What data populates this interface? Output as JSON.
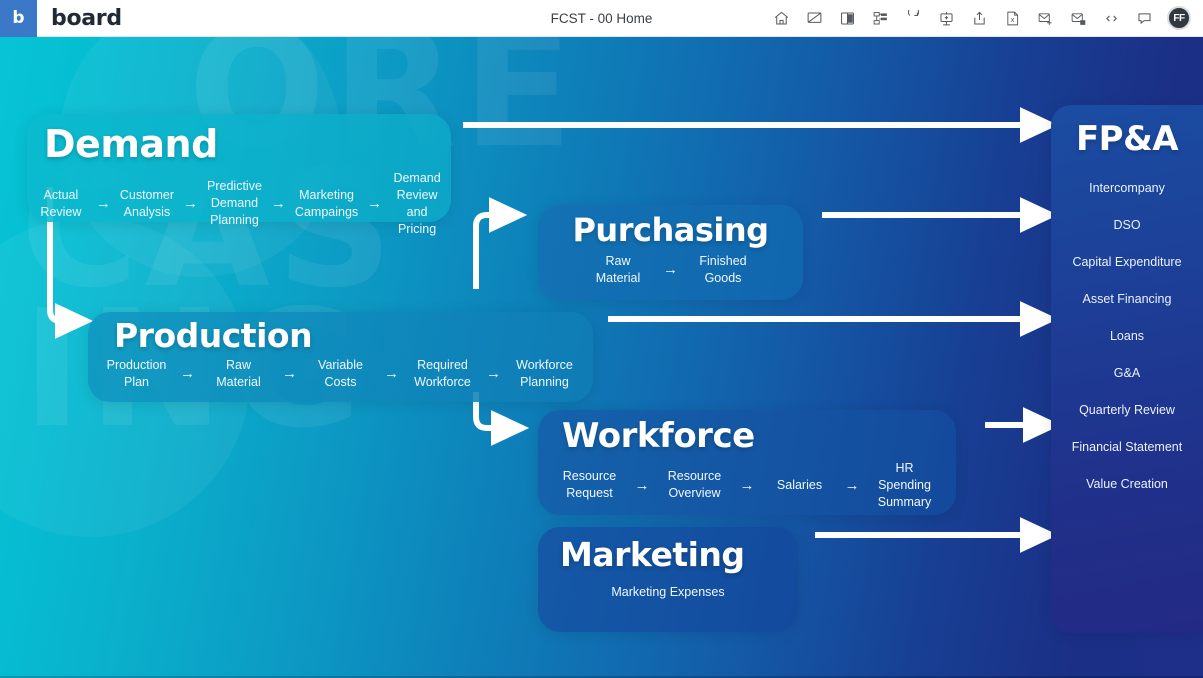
{
  "app": {
    "brand_mark": "b",
    "brand_name": "board",
    "document_title": "FCST - 00 Home",
    "avatar_initials": "FF"
  },
  "toolbar": {
    "icons": [
      {
        "name": "home-icon",
        "label": "Home"
      },
      {
        "name": "screen-off-icon",
        "label": "Screen Off"
      },
      {
        "name": "presentation-icon",
        "label": "Presentation"
      },
      {
        "name": "layout-icon",
        "label": "Layout"
      },
      {
        "name": "undo-icon",
        "label": "Undo"
      },
      {
        "name": "insert-object-icon",
        "label": "Insert Object"
      },
      {
        "name": "share-icon",
        "label": "Share"
      },
      {
        "name": "export-excel-icon",
        "label": "Export to Excel"
      },
      {
        "name": "mail-add-icon",
        "label": "New Mail"
      },
      {
        "name": "mail-schedule-icon",
        "label": "Schedule Mail"
      },
      {
        "name": "code-icon",
        "label": "Code"
      },
      {
        "name": "comment-icon",
        "label": "Comments"
      }
    ]
  },
  "canvas": {
    "watermark_lines": [
      "ORE",
      "CAS",
      "ING"
    ],
    "gradient_from": "#07c4d4",
    "gradient_to": "#1e2f8a"
  },
  "cards": {
    "demand": {
      "title": "Demand",
      "steps": [
        "Actual\nReview",
        "Customer\nAnalysis",
        "Predictive\nDemand\nPlanning",
        "Marketing\nCampaings",
        "Demand\nReview\nand Pricing"
      ]
    },
    "purchasing": {
      "title": "Purchasing",
      "steps": [
        "Raw\nMaterial",
        "Finished\nGoods"
      ]
    },
    "production": {
      "title": "Production",
      "steps": [
        "Production\nPlan",
        "Raw\nMaterial",
        "Variable\nCosts",
        "Required\nWorkforce",
        "Workforce\nPlanning"
      ]
    },
    "workforce": {
      "title": "Workforce",
      "steps": [
        "Resource\nRequest",
        "Resource\nOverview",
        "Salaries",
        "HR Spending\nSummary"
      ]
    },
    "marketing": {
      "title": "Marketing",
      "steps": [
        "Marketing Expenses"
      ]
    },
    "fpa": {
      "title": "FP&A",
      "items": [
        "Intercompany",
        "DSO",
        "Capital Expenditure",
        "Asset Financing",
        "Loans",
        "G&A",
        "Quarterly Review",
        "Financial Statement",
        "Value Creation"
      ]
    }
  },
  "step_arrow_glyph": "→"
}
